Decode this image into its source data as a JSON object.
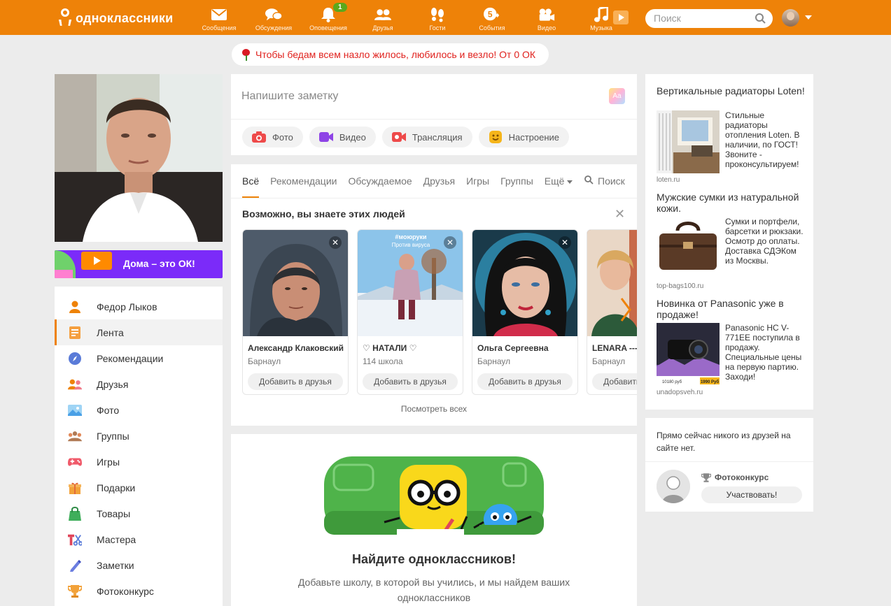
{
  "brand": {
    "name": "одноклассники",
    "accent": "#ee8208"
  },
  "nav": [
    {
      "label": "Сообщения",
      "icon": "envelope-icon"
    },
    {
      "label": "Обсуждения",
      "icon": "chat-bubbles-icon"
    },
    {
      "label": "Оповещения",
      "icon": "bell-icon",
      "badge": "1"
    },
    {
      "label": "Друзья",
      "icon": "friends-icon"
    },
    {
      "label": "Гости",
      "icon": "footprints-icon"
    },
    {
      "label": "События",
      "icon": "events-icon",
      "badge_inline": "5"
    },
    {
      "label": "Видео",
      "icon": "video-camera-icon"
    },
    {
      "label": "Музыка",
      "icon": "music-note-icon"
    }
  ],
  "search": {
    "placeholder": "Поиск"
  },
  "greeting": {
    "text": "Чтобы бедам всем назло жилось, любилось и везло! От 0 ОК"
  },
  "promo": {
    "text": "Дома – это ОК!"
  },
  "menu": [
    {
      "label": "Федор Лыков",
      "icon": "person-icon",
      "color": "#ee8208"
    },
    {
      "label": "Лента",
      "icon": "feed-icon",
      "color": "#f5a040",
      "active": true
    },
    {
      "label": "Рекомендации",
      "icon": "compass-icon",
      "color": "#5a7bd8"
    },
    {
      "label": "Друзья",
      "icon": "friends-icon",
      "color": "#ee8208"
    },
    {
      "label": "Фото",
      "icon": "photo-icon",
      "color": "#4aa0e6"
    },
    {
      "label": "Группы",
      "icon": "groups-icon",
      "color": "#b07a55"
    },
    {
      "label": "Игры",
      "icon": "gamepad-icon",
      "color": "#f05a6a"
    },
    {
      "label": "Подарки",
      "icon": "gift-icon",
      "color": "#f2a23a"
    },
    {
      "label": "Товары",
      "icon": "shopping-bag-icon",
      "color": "#3fae5b"
    },
    {
      "label": "Мастера",
      "icon": "tools-icon",
      "color": "#e0455a"
    },
    {
      "label": "Заметки",
      "icon": "pencil-icon",
      "color": "#6b7de0"
    },
    {
      "label": "Фотоконкурс",
      "icon": "trophy-icon",
      "color": "#f2a23a"
    }
  ],
  "note": {
    "placeholder": "Напишите заметку",
    "actions": [
      {
        "label": "Фото",
        "icon": "camera-icon",
        "color": "#ee4a4a"
      },
      {
        "label": "Видео",
        "icon": "video-icon",
        "color": "#8e44e6"
      },
      {
        "label": "Трансляция",
        "icon": "broadcast-icon",
        "color": "#ee4a4a"
      },
      {
        "label": "Настроение",
        "icon": "smile-icon",
        "color": "#f5b51a"
      }
    ]
  },
  "feed": {
    "tabs": [
      "Всё",
      "Рекомендации",
      "Обсуждаемое",
      "Друзья",
      "Игры",
      "Группы",
      "Ещё"
    ],
    "search_label": "Поиск",
    "pymk_title": "Возможно, вы знаете этих людей",
    "people": [
      {
        "name": "Александр Клаковский",
        "sub": "Барнаул",
        "button": "Добавить в друзья"
      },
      {
        "name": "♡ НАТАЛИ ♡",
        "sub": "114 школа",
        "button": "Добавить в друзья",
        "photo_caption": "#моюруки",
        "photo_caption2": "Против вируса"
      },
      {
        "name": "Ольга Сергеевна",
        "sub": "Барнаул",
        "button": "Добавить в друзья"
      },
      {
        "name": "LENARA ---",
        "sub": "Барнаул",
        "button": "Добавить в друзья"
      }
    ],
    "see_all": "Посмотреть всех"
  },
  "find": {
    "title": "Найдите одноклассников!",
    "desc": "Добавьте школу, в которой вы учились, и мы найдем ваших одноклассников"
  },
  "ads": [
    {
      "title": "Вертикальные радиаторы Loten!",
      "desc": "Стильные радиаторы отопления Loten. В наличии, по ГОСТ! Звоните - проконсультируем!",
      "domain": "loten.ru"
    },
    {
      "title": "Мужские сумки из натуральной кожи.",
      "desc": "Сумки и портфели, барсетки и рюкзаки. Осмотр до оплаты. Доставка СДЭКом из Москвы.",
      "domain": "top-bags100.ru"
    },
    {
      "title": "Новинка от Panasonic уже в продаже!",
      "desc": "Panasonic HC V-771EE поступила в продажу. Специальные цены на первую партию. Заходи!",
      "domain": "unadopsveh.ru",
      "price_old": "10180 руб",
      "price_new": "1990 Руб"
    }
  ],
  "friends_online": {
    "text": "Прямо сейчас никого из друзей на сайте нет.",
    "label": "Фотоконкурс",
    "button": "Участвовать!"
  }
}
